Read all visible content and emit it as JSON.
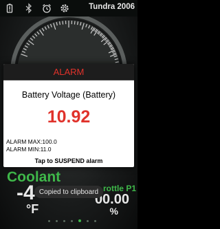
{
  "status_bar": {
    "title": "Tundra 2006",
    "icons": [
      "battery-alert-icon",
      "bluetooth-icon",
      "alarm-clock-icon",
      "settings-gear-icon"
    ]
  },
  "dashboard": {
    "coolant": {
      "label": "Coolant",
      "value": "-4",
      "unit": "°F"
    },
    "throttle": {
      "label": "rottle P1",
      "value": "00.00",
      "unit": "%"
    },
    "page_dots": {
      "count": 7,
      "active_index": 4
    }
  },
  "alarm": {
    "header": "ALARM",
    "sensor": "Battery Voltage (Battery)",
    "value": "10.92",
    "max": "ALARM MAX:100.0",
    "min": "ALARM MIN:11.0",
    "action": "Tap to SUSPEND alarm"
  },
  "toast": {
    "text": "Copied to clipboard"
  },
  "colors": {
    "accent_green": "#3fb84a",
    "alarm_red": "#e0322b",
    "header_dark": "#1d1d1d"
  }
}
